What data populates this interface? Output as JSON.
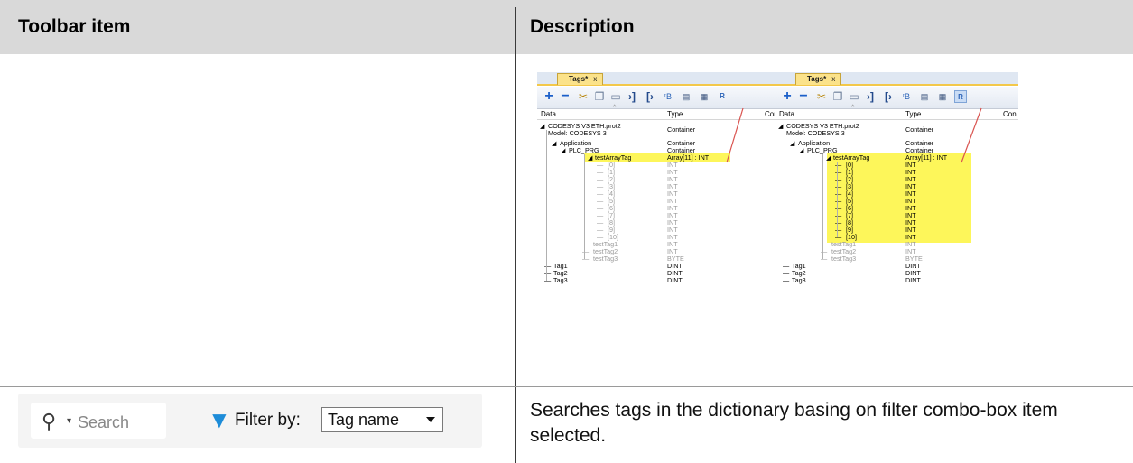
{
  "header": {
    "col1": "Toolbar item",
    "col2": "Description"
  },
  "tag_editor": {
    "tab_title": "Tags*",
    "tab_close": "x",
    "columns": {
      "data": "Data",
      "type": "Type",
      "third": "Con"
    },
    "root_line1": "CODESYS V3 ETH:prot2",
    "root_line2": "Model: CODESYS 3",
    "root_type": "Container",
    "application": "Application",
    "application_type": "Container",
    "plc_prg": "PLC_PRG",
    "plc_prg_type": "Container",
    "array_tag": "testArrayTag",
    "array_tag_type": "Array[11] : INT",
    "elements": [
      "[0]",
      "[1]",
      "[2]",
      "[3]",
      "[4]",
      "[5]",
      "[6]",
      "[7]",
      "[8]",
      "[9]",
      "[10]"
    ],
    "element_type": "INT",
    "test_tags": [
      {
        "name": "testTag1",
        "type": "INT"
      },
      {
        "name": "testTag2",
        "type": "INT"
      },
      {
        "name": "testTag3",
        "type": "BYTE"
      }
    ],
    "tags": [
      {
        "name": "Tag1",
        "type": "DINT"
      },
      {
        "name": "Tag2",
        "type": "DINT"
      },
      {
        "name": "Tag3",
        "type": "DINT"
      }
    ]
  },
  "controls": {
    "search_placeholder": "Search",
    "filter_label": "Filter by:",
    "filter_value": "Tag name"
  },
  "description2": "Searches tags in the dictionary basing on filter combo-box item selected.",
  "colors": {
    "highlight": "#fdf65a",
    "tab": "#fbe28a",
    "filter_icon": "#1d8cd8",
    "annotation": "#d9534f"
  }
}
